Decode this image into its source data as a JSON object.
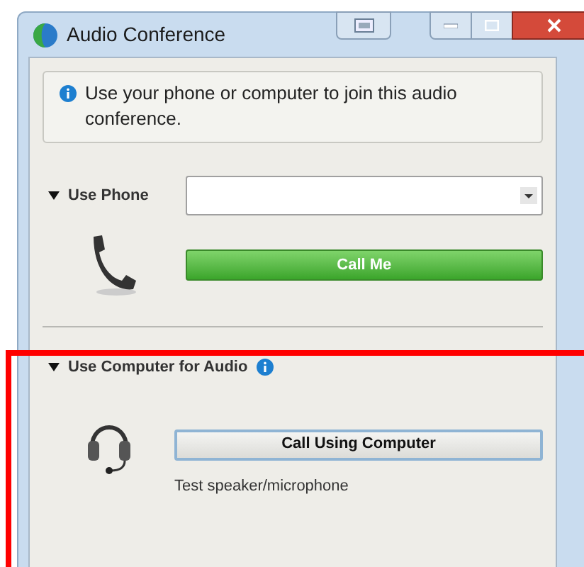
{
  "window": {
    "title": "Audio Conference"
  },
  "info": {
    "message": "Use your phone or computer to join this audio conference."
  },
  "phone": {
    "label": "Use Phone",
    "expanded": true,
    "call_button": "Call Me"
  },
  "computer": {
    "label": "Use Computer for Audio",
    "expanded": true,
    "highlighted": true,
    "call_button": "Call Using Computer",
    "test_link": "Test speaker/microphone"
  }
}
